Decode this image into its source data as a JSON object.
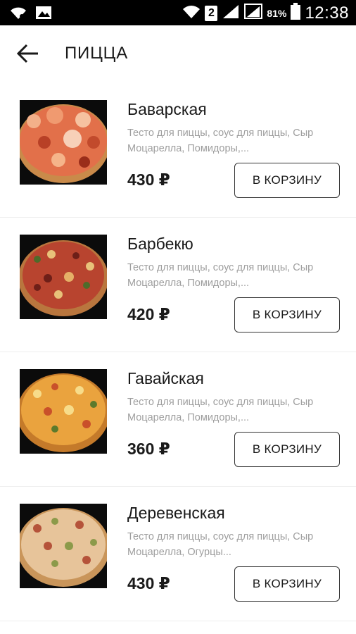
{
  "status_bar": {
    "left_icons": [
      "wifi-signal-icon",
      "image-icon"
    ],
    "right_icons": [
      "wifi-icon",
      "sim-2-icon",
      "signal-icon",
      "signal-r-icon",
      "battery-icon"
    ],
    "sim_label": "2",
    "battery": "81%",
    "time": "12:38"
  },
  "app_bar": {
    "back_icon": "arrow-left-icon",
    "title": "ПИЦЦА"
  },
  "products": [
    {
      "name": "Баварская",
      "description": "Тесто для пиццы, соус для пиццы, Сыр Моцарелла, Помидоры,...",
      "price": "430 ₽",
      "button_label": "В КОРЗИНУ",
      "thumb_tone": "#d95b3b"
    },
    {
      "name": "Барбекю",
      "description": "Тесто для пиццы, соус для пиццы, Сыр Моцарелла, Помидоры,...",
      "price": "420 ₽",
      "button_label": "В КОРЗИНУ",
      "thumb_tone": "#b5422f"
    },
    {
      "name": "Гавайская",
      "description": "Тесто для пиццы, соус для пиццы, Сыр Моцарелла, Помидоры,...",
      "price": "360 ₽",
      "button_label": "В КОРЗИНУ",
      "thumb_tone": "#e39a3a"
    },
    {
      "name": "Деревенская",
      "description": "Тесто для пиццы, соус для пиццы, Сыр Моцарелла, Огурцы...",
      "price": "430 ₽",
      "button_label": "В КОРЗИНУ",
      "thumb_tone": "#d9b58a"
    }
  ],
  "colors": {
    "status_bar_bg": "#000000",
    "text_primary": "#1a1a1a",
    "text_secondary": "#9e9e9e",
    "button_border": "#333333"
  }
}
